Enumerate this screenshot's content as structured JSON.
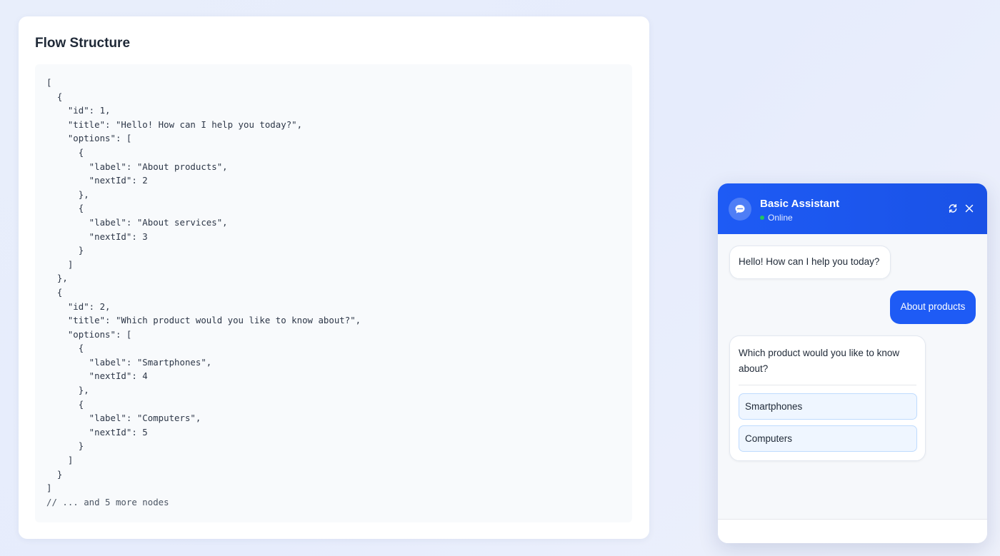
{
  "flow_panel": {
    "title": "Flow Structure",
    "code": "[\n  {\n    \"id\": 1,\n    \"title\": \"Hello! How can I help you today?\",\n    \"options\": [\n      {\n        \"label\": \"About products\",\n        \"nextId\": 2\n      },\n      {\n        \"label\": \"About services\",\n        \"nextId\": 3\n      }\n    ]\n  },\n  {\n    \"id\": 2,\n    \"title\": \"Which product would you like to know about?\",\n    \"options\": [\n      {\n        \"label\": \"Smartphones\",\n        \"nextId\": 4\n      },\n      {\n        \"label\": \"Computers\",\n        \"nextId\": 5\n      }\n    ]\n  }\n]",
    "comment": "// ... and 5 more nodes"
  },
  "chat": {
    "assistant_name": "Basic Assistant",
    "status": "Online",
    "header_icons": [
      "chat-bubble-icon",
      "refresh-icon",
      "close-icon"
    ],
    "messages": [
      {
        "from": "bot",
        "text": "Hello! How can I help you today?"
      },
      {
        "from": "user",
        "text": "About products"
      },
      {
        "from": "bot",
        "text": "Which product would you like to know about?",
        "options": [
          "Smartphones",
          "Computers"
        ]
      }
    ]
  },
  "colors": {
    "accent": "#1e5bf5",
    "online": "#22c55e",
    "option_bg": "#eff6ff",
    "option_border": "#bfdbfe"
  }
}
